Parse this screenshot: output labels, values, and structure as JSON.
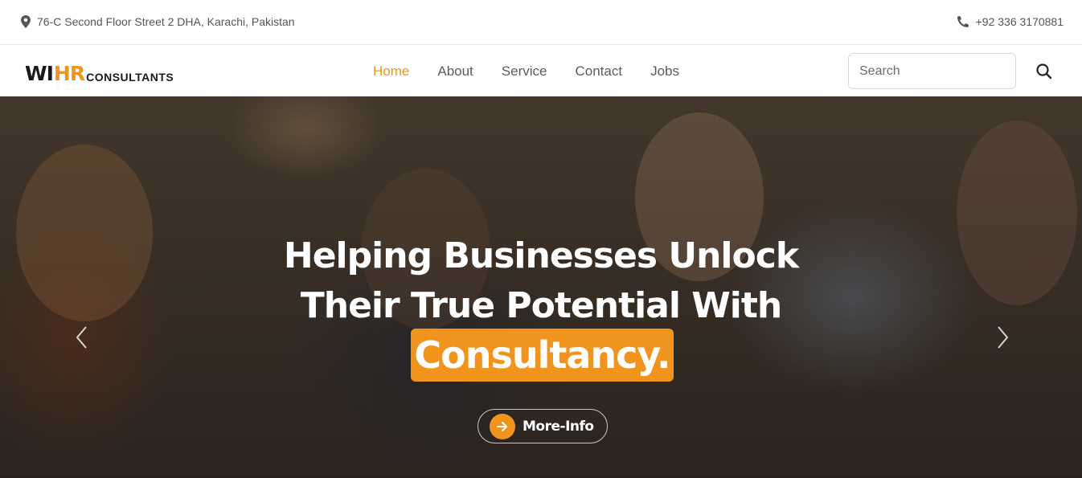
{
  "topbar": {
    "address": "76-C Second Floor Street 2 DHA, Karachi, Pakistan",
    "phone": "+92 336 3170881"
  },
  "logo": {
    "part1": "WI",
    "part2": "HR",
    "part3": "CONSULTANTS"
  },
  "nav": {
    "items": [
      {
        "label": "Home",
        "active": true
      },
      {
        "label": "About",
        "active": false
      },
      {
        "label": "Service",
        "active": false
      },
      {
        "label": "Contact",
        "active": false
      },
      {
        "label": "Jobs",
        "active": false
      }
    ]
  },
  "search": {
    "placeholder": "Search",
    "icon": "search-icon"
  },
  "hero": {
    "line1": "Helping Businesses Unlock",
    "line2": "Their True Potential With",
    "highlight": "Consultancy.",
    "button_label": "More-Info",
    "prev_icon": "chevron-left-icon",
    "next_icon": "chevron-right-icon"
  },
  "colors": {
    "accent": "#f0941e",
    "text_dark": "#1a1a1a",
    "nav_text": "#5c5c5c"
  }
}
